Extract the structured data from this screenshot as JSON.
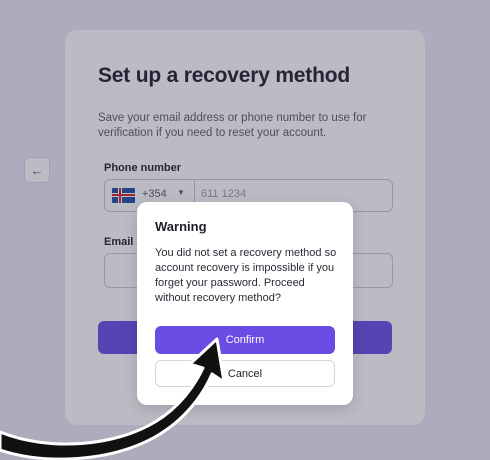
{
  "page": {
    "title": "Set up a recovery method",
    "subtitle": "Save your email address or phone number to use for verification if you need to reset your account.",
    "back_icon": "arrow-left-icon",
    "phone": {
      "label": "Phone number",
      "country_flag": "iceland-flag-icon",
      "dial_code": "+354",
      "placeholder": "611 1234"
    },
    "email": {
      "label": "Email a"
    }
  },
  "dialog": {
    "title": "Warning",
    "message": "You did not set a recovery method so account recovery is impossible if you forget your password. Proceed without recovery method?",
    "confirm_label": "Confirm",
    "cancel_label": "Cancel"
  },
  "colors": {
    "accent": "#6b4de6",
    "annotation_arrow": "#111111"
  }
}
